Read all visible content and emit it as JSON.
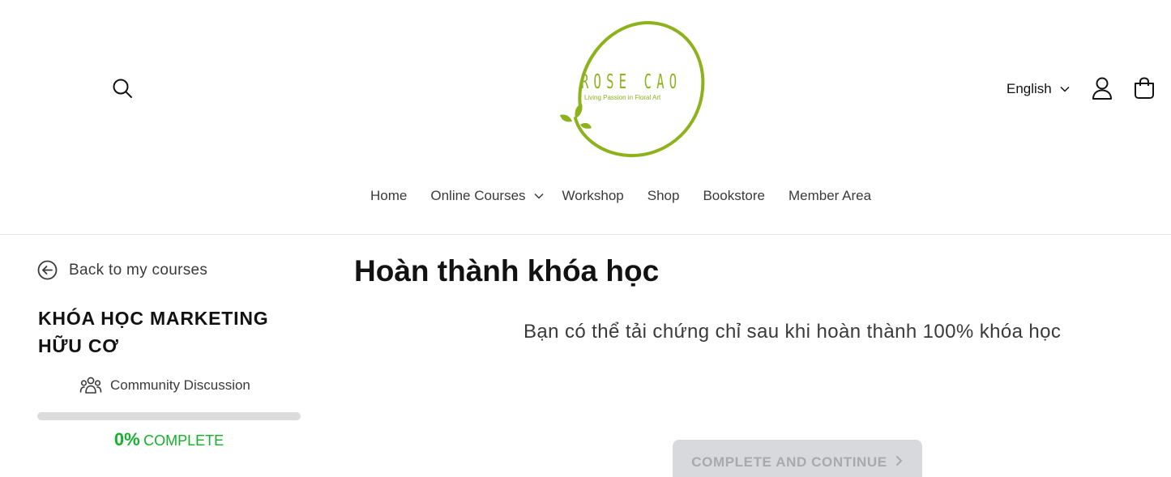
{
  "header": {
    "logo": {
      "name": "ROSE CAO",
      "tagline": "Living Passion in Floral Art",
      "color": "#8db21c"
    },
    "language": {
      "selected": "English"
    },
    "icons": {
      "search": "search-icon",
      "account": "account-icon",
      "cart": "cart-icon"
    }
  },
  "nav": {
    "items": [
      {
        "label": "Home"
      },
      {
        "label": "Online Courses"
      },
      {
        "label": "Workshop"
      },
      {
        "label": "Shop"
      },
      {
        "label": "Bookstore"
      },
      {
        "label": "Member Area"
      }
    ]
  },
  "sidebar": {
    "back_label": "Back to my courses",
    "course_title": "KHÓA HỌC MARKETING HỮU CƠ",
    "community_label": "Community Discussion",
    "progress": {
      "value": 0,
      "percent_text": "0%",
      "label": "COMPLETE",
      "color": "#15b02c"
    }
  },
  "main": {
    "title": "Hoàn thành khóa học",
    "message": "Bạn có thể tải chứng chỉ sau khi hoàn thành 100% khóa học",
    "button_label": "COMPLETE AND CONTINUE"
  }
}
